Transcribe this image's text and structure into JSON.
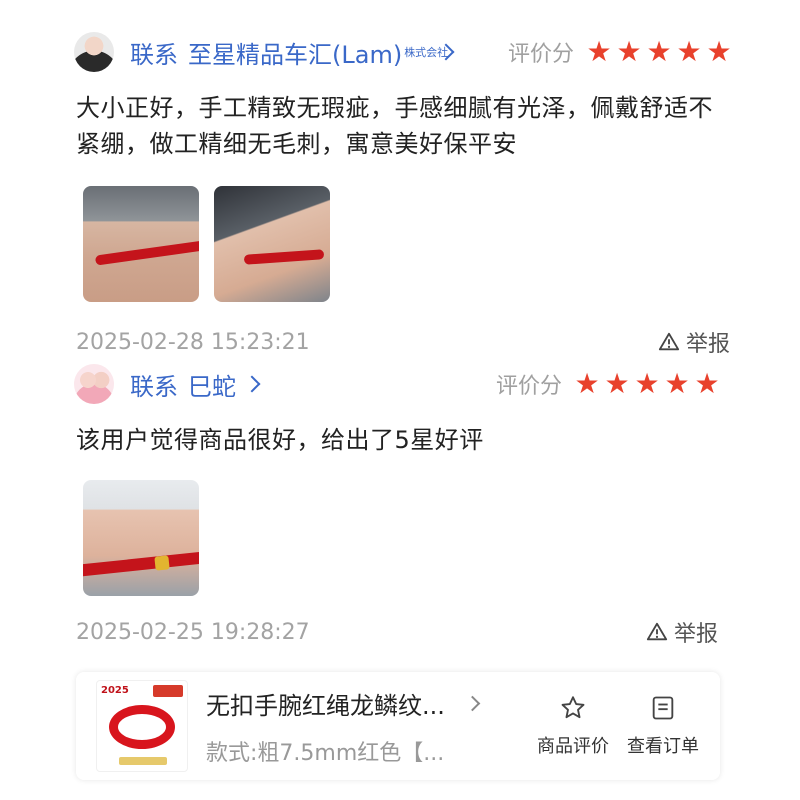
{
  "reviews": [
    {
      "contact_label": "联系",
      "username": "至星精品车汇(Lam)",
      "corp_tag": "株式会社",
      "rating_label": "评价分",
      "stars": 5,
      "text": "大小正好，手工精致无瑕疵，手感细腻有光泽，佩戴舒适不紧绷，做工精细无毛刺，寓意美好保平安",
      "photo_count": 2,
      "timestamp": "2025-02-28 15:23:21",
      "report_label": "举报"
    },
    {
      "contact_label": "联系",
      "username": "巳蛇",
      "rating_label": "评价分",
      "stars": 5,
      "text": "该用户觉得商品很好，给出了5星好评",
      "photo_count": 1,
      "timestamp": "2025-02-25 19:28:27",
      "report_label": "举报"
    }
  ],
  "product": {
    "title": "无扣手腕红绳龙鳞纹...",
    "spec": "款式:粗7.5mm红色【...",
    "thumb_year": "2025",
    "actions": [
      {
        "label": "商品评价",
        "icon": "star-outline-icon"
      },
      {
        "label": "查看订单",
        "icon": "order-document-icon"
      }
    ]
  },
  "colors": {
    "link_blue": "#3a68c8",
    "star_red": "#e8412c",
    "muted_gray": "#a3a3a3"
  }
}
